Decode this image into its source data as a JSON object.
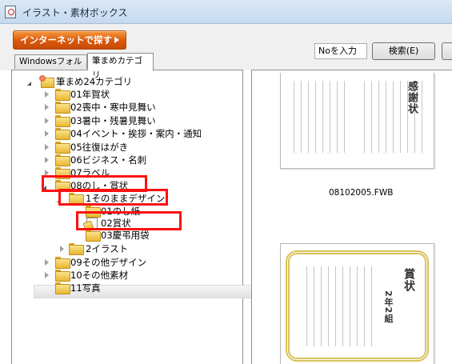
{
  "window": {
    "title": "イラスト・素材ボックス"
  },
  "toolbar": {
    "internet_button": "インターネットで探す",
    "no_input_value": "Noを入力",
    "search_button": "検索(E)"
  },
  "tabs": [
    {
      "label": "Windowsフォルダ",
      "active": false
    },
    {
      "label": "筆まめカテゴリ",
      "active": true
    }
  ],
  "tree": {
    "root": "筆まめ24カテゴリ",
    "items": [
      "01年賀状",
      "02喪中・寒中見舞い",
      "03暑中・残暑見舞い",
      "04イベント・挨拶・案内・通知",
      "05往復はがき",
      "06ビジネス・名刺",
      "07ラベル",
      "08のし・賞状",
      "1そのままデザイン",
      "01のし紙",
      "02賞状",
      "03慶弔用袋",
      "2イラスト",
      "09その他デザイン",
      "10その他素材",
      "11写真"
    ],
    "selected": "02賞状"
  },
  "preview": {
    "files": [
      {
        "name": "08102005.FWB",
        "heading": "感謝状"
      },
      {
        "name": "",
        "heading": "賞状",
        "subtitle": "2年2組"
      }
    ]
  },
  "colors": {
    "accent_orange": "#d8580c",
    "highlight_red": "#ff1010",
    "folder_yellow": "#e7b730"
  }
}
